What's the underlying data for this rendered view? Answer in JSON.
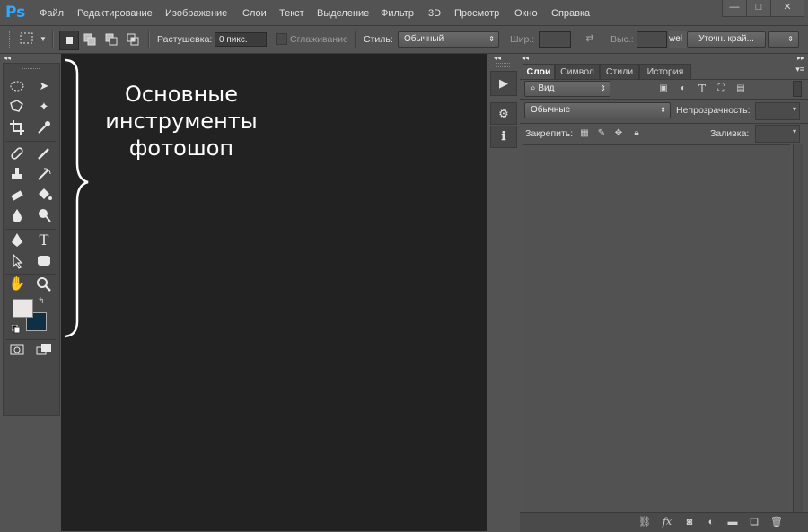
{
  "app": {
    "logo": "Ps"
  },
  "menu": [
    "Файл",
    "Редактирование",
    "Изображение",
    "Слои",
    "Текст",
    "Выделение",
    "Фильтр",
    "3D",
    "Просмотр",
    "Окно",
    "Справка"
  ],
  "window_buttons": {
    "minimize": "—",
    "restore": "□",
    "close": "✕"
  },
  "options": {
    "feather_label": "Растушевка:",
    "feather_value": "0 пикс.",
    "antialias_label": "Сглаживание",
    "style_label": "Стиль:",
    "style_value": "Обычный",
    "width_label": "Шир.:",
    "height_label": "Выс.:",
    "partial_text": "wel",
    "refine_edge_label": "Уточн. край..."
  },
  "annotation": {
    "line1": "Основные",
    "line2": "инструменты",
    "line3": "фотошоп"
  },
  "panel": {
    "tabs": [
      "Слои",
      "Символ",
      "Стили",
      "История"
    ],
    "active_tab": "Слои",
    "filter_kind": "Вид",
    "blend_mode": "Обычные",
    "opacity_label": "Непрозрачность:",
    "lock_label": "Закрепить:",
    "fill_label": "Заливка:"
  },
  "colors": {
    "foreground": "#eae6e6",
    "background": "#0e2f44",
    "ps_blue": "#31a8ff"
  },
  "icons": {
    "bottom": [
      "link-icon",
      "fx-icon",
      "mask-icon",
      "adjustment-icon",
      "group-folder-icon",
      "new-layer-icon",
      "trash-icon"
    ]
  }
}
